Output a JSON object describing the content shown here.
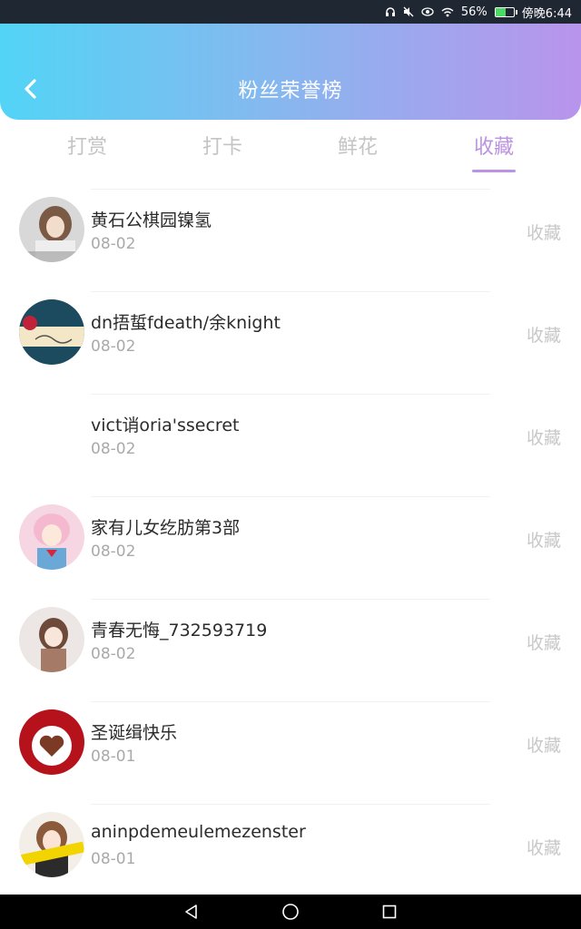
{
  "status_bar": {
    "battery_percent": "56%",
    "time": "傍晚6:44",
    "battery_level": 0.56,
    "icons": [
      "headset-icon",
      "mute-icon",
      "eye-icon",
      "wifi-icon",
      "battery-icon"
    ]
  },
  "header": {
    "title": "粉丝荣誉榜",
    "back_icon": "chevron-left-icon"
  },
  "tabs": [
    {
      "label": "打赏",
      "active": false
    },
    {
      "label": "打卡",
      "active": false
    },
    {
      "label": "鲜花",
      "active": false
    },
    {
      "label": "收藏",
      "active": true
    }
  ],
  "fans": [
    {
      "name": "黄石公棋园镍氢",
      "date": "08-02",
      "action": "收藏"
    },
    {
      "name": "dn捂蜇fdeath/余knight",
      "date": "08-02",
      "action": "收藏"
    },
    {
      "name": "vict诮oria'ssecret",
      "date": "08-02",
      "action": "收藏"
    },
    {
      "name": "家有儿女纥肪第3部",
      "date": "08-02",
      "action": "收藏"
    },
    {
      "name": "青春无悔_732593719",
      "date": "08-02",
      "action": "收藏"
    },
    {
      "name": "圣诞缉快乐",
      "date": "08-01",
      "action": "收藏"
    },
    {
      "name": "aninpdemeulemezenster",
      "date": "08-01",
      "action": "收藏"
    }
  ],
  "colors": {
    "accent": "#bb93e3",
    "header_start": "#52d4f6",
    "header_end": "#b994ec"
  },
  "nav_bar": {
    "icons": [
      "back-triangle-icon",
      "home-circle-icon",
      "recents-square-icon"
    ]
  }
}
